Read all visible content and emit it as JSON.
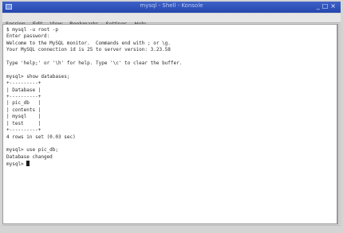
{
  "window": {
    "title": "mysql - Shell - Konsole"
  },
  "menubar": {
    "items": [
      "Session",
      "Edit",
      "View",
      "Bookmarks",
      "Settings",
      "Help"
    ]
  },
  "terminal": {
    "lines": [
      "$ mysql -u root -p",
      "Enter password:",
      "Welcome to the MySQL monitor.  Commands end with ; or \\g.",
      "Your MySQL connection id is 25 to server version: 3.23.58",
      "",
      "Type 'help;' or '\\h' for help. Type '\\c' to clear the buffer.",
      "",
      "mysql> show databases;",
      "+----------+",
      "| Database |",
      "+----------+",
      "| pic_db   |",
      "| contents |",
      "| mysql    |",
      "| test     |",
      "+----------+",
      "4 rows in set (0.03 sec)",
      "",
      "mysql> use pic_db;",
      "Database changed"
    ],
    "prompt": "mysql> "
  }
}
